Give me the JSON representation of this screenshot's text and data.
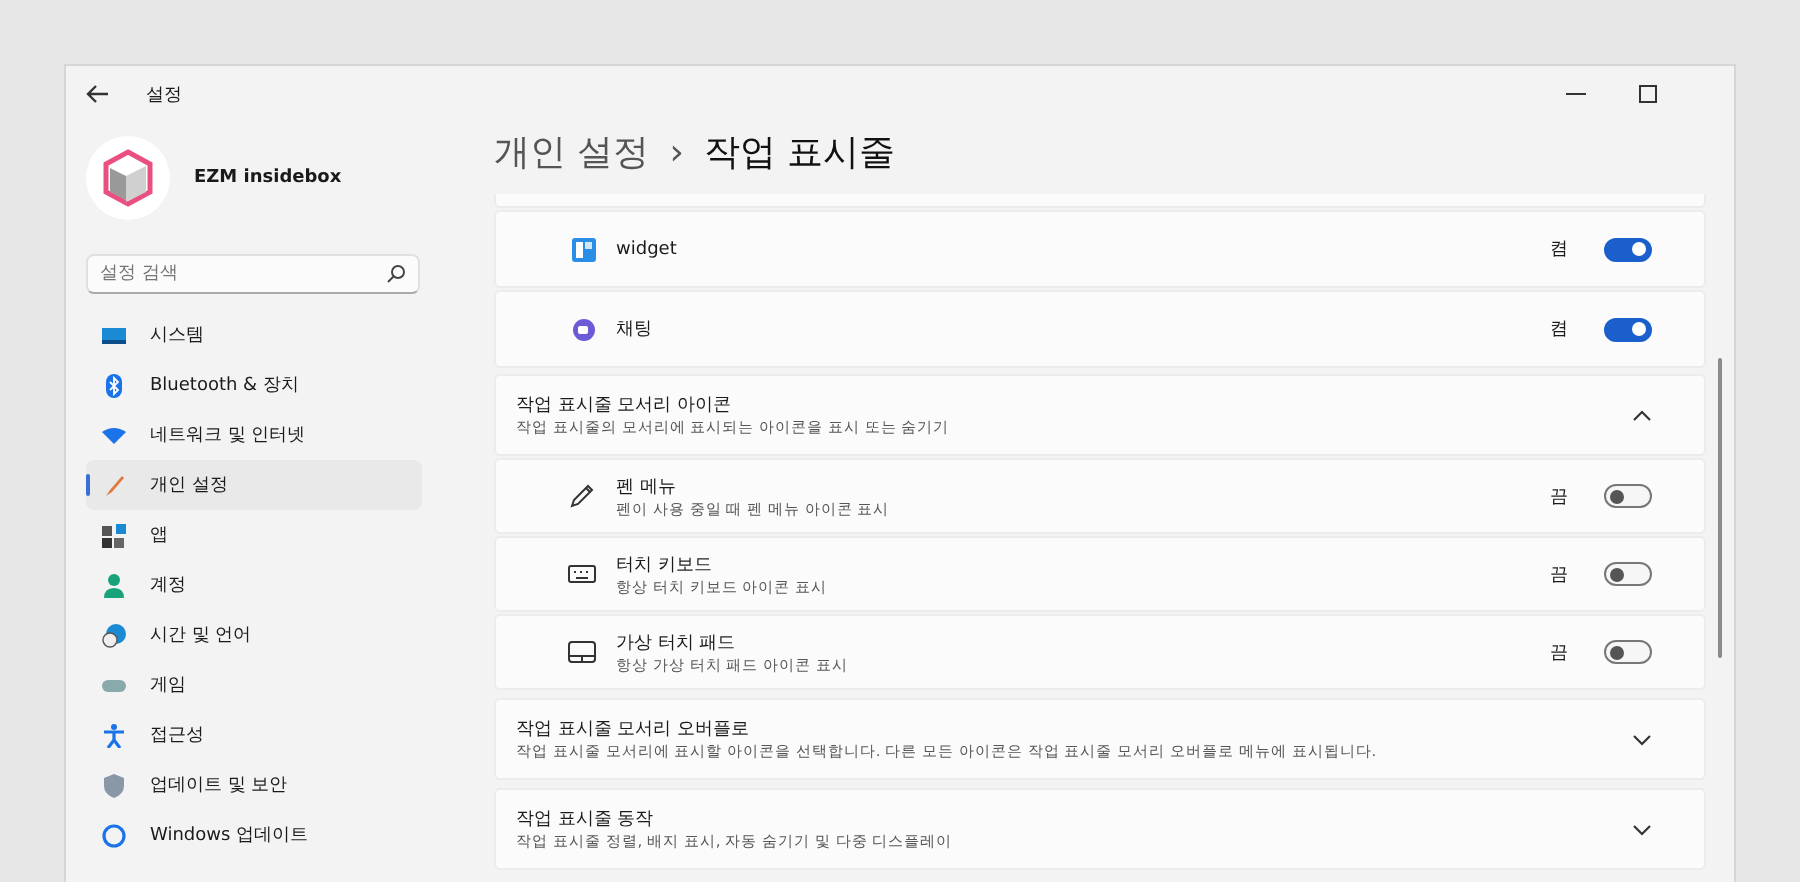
{
  "window": {
    "title": "설정"
  },
  "account": {
    "name": "EZM insidebox"
  },
  "search": {
    "placeholder": "설정 검색"
  },
  "sidebar": {
    "items": [
      {
        "label": "시스템",
        "kind": "system",
        "selected": false
      },
      {
        "label": "Bluetooth & 장치",
        "kind": "bluetooth",
        "selected": false
      },
      {
        "label": "네트워크 및 인터넷",
        "kind": "network",
        "selected": false
      },
      {
        "label": "개인 설정",
        "kind": "personal",
        "selected": true
      },
      {
        "label": "앱",
        "kind": "apps",
        "selected": false
      },
      {
        "label": "계정",
        "kind": "account",
        "selected": false
      },
      {
        "label": "시간 및 언어",
        "kind": "time",
        "selected": false
      },
      {
        "label": "게임",
        "kind": "game",
        "selected": false
      },
      {
        "label": "접근성",
        "kind": "access",
        "selected": false
      },
      {
        "label": "업데이트 및 보안",
        "kind": "shield",
        "selected": false
      },
      {
        "label": "Windows 업데이트",
        "kind": "update",
        "selected": false
      }
    ]
  },
  "breadcrumb": {
    "parent": "개인 설정",
    "separator": "›",
    "current": "작업 표시줄"
  },
  "taskbar_items": [
    {
      "label": "widget",
      "kind": "widget",
      "on": true,
      "state_label": "켬"
    },
    {
      "label": "채팅",
      "kind": "chat",
      "on": true,
      "state_label": "켬"
    }
  ],
  "sections": [
    {
      "title": "작업 표시줄 모서리 아이콘",
      "description": "작업 표시줄의 모서리에 표시되는 아이콘을 표시 또는 숨기기",
      "expanded": true,
      "items": [
        {
          "label": "펜 메뉴",
          "description": "펜이 사용 중일 때 펜 메뉴 아이콘 표시",
          "kind": "pen",
          "on": false,
          "state_label": "끔"
        },
        {
          "label": "터치 키보드",
          "description": "항상 터치 키보드 아이콘 표시",
          "kind": "keyboard",
          "on": false,
          "state_label": "끔"
        },
        {
          "label": "가상 터치 패드",
          "description": "항상 가상 터치 패드 아이콘 표시",
          "kind": "touchpad",
          "on": false,
          "state_label": "끔"
        }
      ]
    },
    {
      "title": "작업 표시줄 모서리 오버플로",
      "description": "작업 표시줄 모서리에 표시할 아이콘을 선택합니다. 다른 모든 아이콘은 작업 표시줄 모서리 오버플로 메뉴에 표시됩니다.",
      "expanded": false
    },
    {
      "title": "작업 표시줄 동작",
      "description": "작업 표시줄 정렬, 배지 표시, 자동 숨기기 및 다중 디스플레이",
      "expanded": false
    }
  ]
}
